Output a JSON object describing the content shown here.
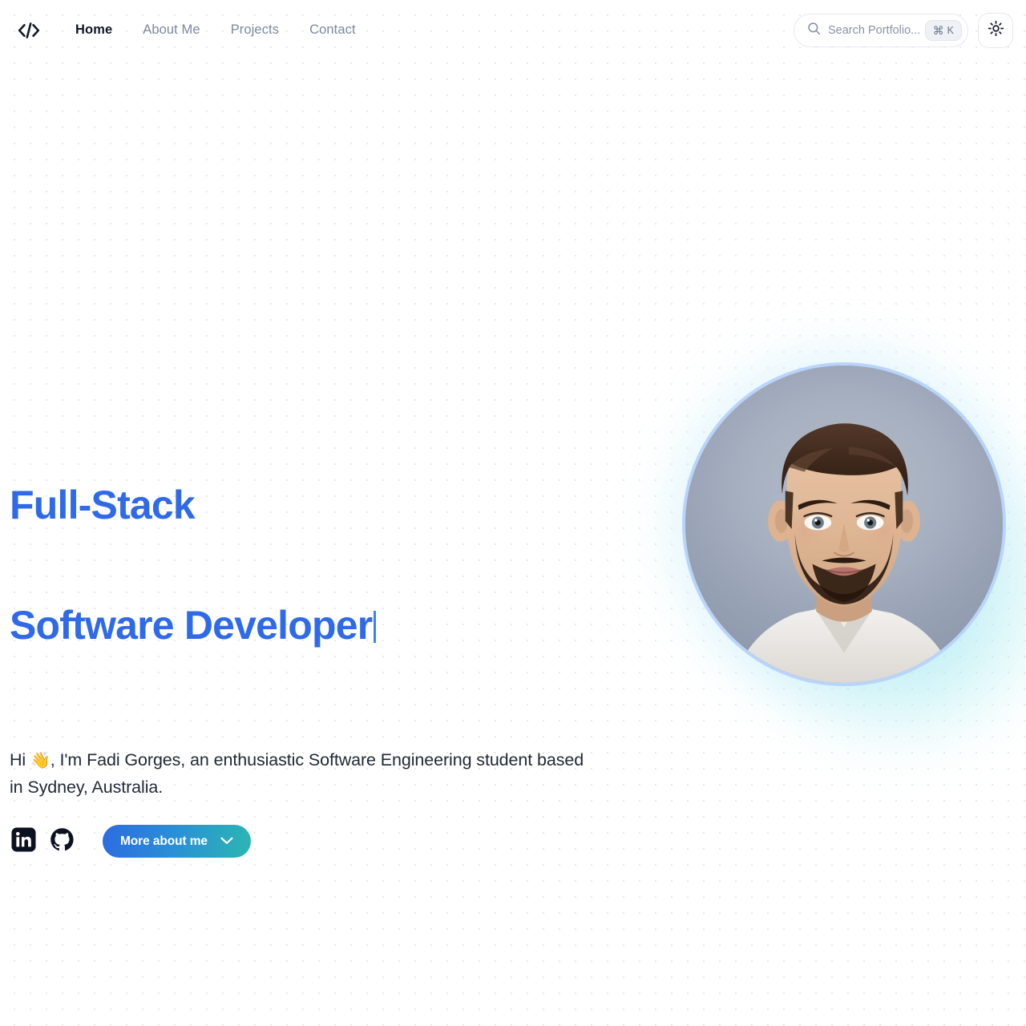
{
  "header": {
    "logo_icon": "code-brackets-icon",
    "nav": [
      {
        "label": "Home",
        "active": true
      },
      {
        "label": "About Me",
        "active": false
      },
      {
        "label": "Projects",
        "active": false
      },
      {
        "label": "Contact",
        "active": false
      }
    ],
    "search": {
      "placeholder": "Search Portfolio...",
      "value": "",
      "icon": "search-icon",
      "shortcut_modifier": "⌘",
      "shortcut_key": "K"
    },
    "theme_toggle": {
      "icon": "sun-icon",
      "mode": "light"
    }
  },
  "hero": {
    "title_line1": "Full-Stack",
    "title_line2": "Software Developer",
    "title_color": "#2f6ae8",
    "typing_caret": true,
    "subtitle_prefix": "Hi ",
    "subtitle_emoji": "👋",
    "subtitle_rest": ", I'm Fadi Gorges, an enthusiastic Software Engineering student based in Sydney, Australia.",
    "socials": [
      {
        "name": "LinkedIn",
        "icon": "linkedin-icon"
      },
      {
        "name": "GitHub",
        "icon": "github-icon"
      }
    ],
    "cta": {
      "label": "More about me",
      "icon": "chevron-down-icon",
      "gradient_from": "#2d6ce0",
      "gradient_to": "#2bb6b3"
    },
    "portrait": {
      "alt": "Portrait photo of Fadi Gorges",
      "ring_color": "#b9d4fb",
      "glow_color": "#8cc8ff"
    }
  },
  "background": {
    "color": "#ffffff",
    "dot_color": "#e9e9ed",
    "dot_spacing_px": 20
  }
}
